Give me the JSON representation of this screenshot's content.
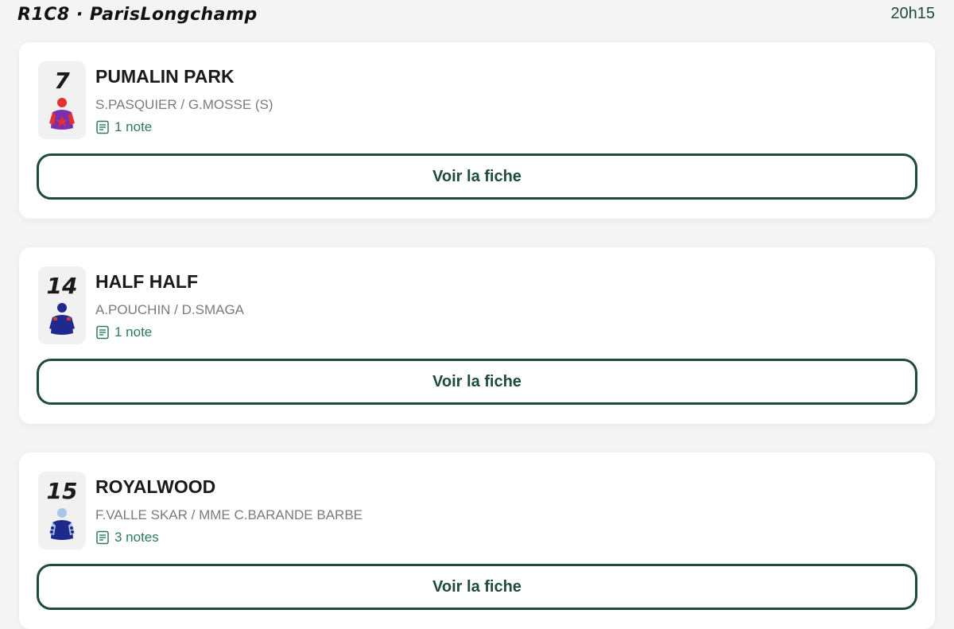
{
  "header": {
    "race": "R1C8 · ParisLongchamp",
    "time": "20h15"
  },
  "runners": [
    {
      "number": "7",
      "name": "PUMALIN PARK",
      "jockey_trainer": "S.PASQUIER / G.MOSSE (S)",
      "notes": "1 note",
      "button": "Voir la fiche",
      "silk_icon": "jockey-silk-icon",
      "silk_colors": {
        "body": "#7a2fb0",
        "sleeves": "#e0322e",
        "cap": "#e0322e",
        "motif": "#e0322e"
      }
    },
    {
      "number": "14",
      "name": "HALF HALF",
      "jockey_trainer": "A.POUCHIN / D.SMAGA",
      "notes": "1 note",
      "button": "Voir la fiche",
      "silk_icon": "jockey-silk-icon",
      "silk_colors": {
        "body": "#1f2a8c",
        "sleeves": "#1f2a8c",
        "cap": "#1f2a8c",
        "motif": "#d23a3a"
      }
    },
    {
      "number": "15",
      "name": "ROYALWOOD",
      "jockey_trainer": "F.VALLE SKAR / MME C.BARANDE BARBE",
      "notes": "3 notes",
      "button": "Voir la fiche",
      "silk_icon": "jockey-silk-icon",
      "silk_colors": {
        "body": "#1f2a8c",
        "sleeves": "#a9c6ea",
        "cap": "#a9c6ea",
        "motif": "#a9c6ea"
      }
    }
  ],
  "colors": {
    "accent": "#1e4a3f",
    "notes_text": "#2e7a5c",
    "secondary_text": "#7b7b7b"
  }
}
